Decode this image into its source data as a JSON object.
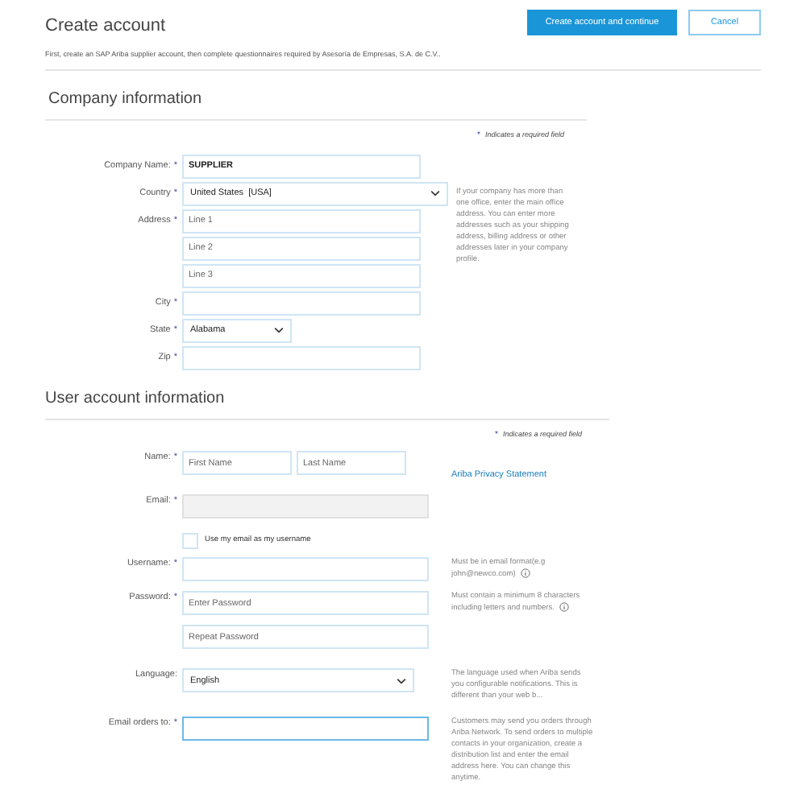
{
  "header": {
    "title": "Create account",
    "subtitle": "First, create an SAP Ariba supplier account, then complete questionnaires required by Asesoría de Empresas, S.A. de C.V.."
  },
  "buttons": [
    {
      "label": "Create account and continue",
      "kind": "primary"
    },
    {
      "label": "Cancel",
      "kind": "secondary"
    }
  ],
  "company": {
    "heading": "Company information",
    "required_note": {
      "mark": "*",
      "text": "Indicates a required field"
    },
    "help": "If your company has more than one office, enter the main office address. You can enter more addresses such as your shipping address, billing address or other addresses later in your company profile.",
    "rows": [
      {
        "kind": "text",
        "label": "Company Name:",
        "mark": "*",
        "value": "SUPPLIER"
      },
      {
        "kind": "select",
        "label": "Country",
        "mark": "*",
        "value": "United States  [USA]",
        "wide": true
      },
      {
        "kind": "text",
        "label": "Address",
        "mark": "*",
        "placeholder": "Line 1"
      },
      {
        "kind": "text",
        "placeholder": "Line 2"
      },
      {
        "kind": "text",
        "placeholder": "Line 3"
      },
      {
        "kind": "text",
        "label": "City",
        "mark": "*"
      },
      {
        "kind": "select",
        "label": "State",
        "mark": "*",
        "value": "Alabama",
        "wide": false
      },
      {
        "kind": "text",
        "label": "Zip",
        "mark": "*"
      }
    ]
  },
  "user": {
    "heading": "User account information",
    "required_note": {
      "mark": "*",
      "text": "Indicates a required field"
    },
    "rows": [
      {
        "kind": "name",
        "label": "Name:",
        "mark": "*",
        "placeholders": [
          "First Name",
          "Last Name"
        ],
        "link": "Ariba Privacy Statement"
      },
      {
        "kind": "text",
        "label": "Email:",
        "mark": "*",
        "disabled": true
      },
      {
        "kind": "checkbox",
        "label": "Use my email as my username",
        "checked": false
      },
      {
        "kind": "text",
        "label": "Username:",
        "mark": "*",
        "help": "Must be in email format(e.g john@newco.com)",
        "info": true
      },
      {
        "kind": "text",
        "label": "Password:",
        "mark": "*",
        "placeholder": "Enter Password",
        "help": "Must contain a minimum 8 characters including letters and numbers.",
        "info": true
      },
      {
        "kind": "text",
        "placeholder": "Repeat Password"
      },
      {
        "kind": "select",
        "label": "Language:",
        "value": "English",
        "help": "The language used when Ariba sends you configurable notifications. This is different than your web b..."
      },
      {
        "kind": "text",
        "label": "Email orders to:",
        "mark": "*",
        "focused": true,
        "help": "Customers may send you orders through Ariba Network. To send orders to multiple contacts in your organization, create a distribution list and enter the email address here. You can change this anytime."
      }
    ]
  }
}
